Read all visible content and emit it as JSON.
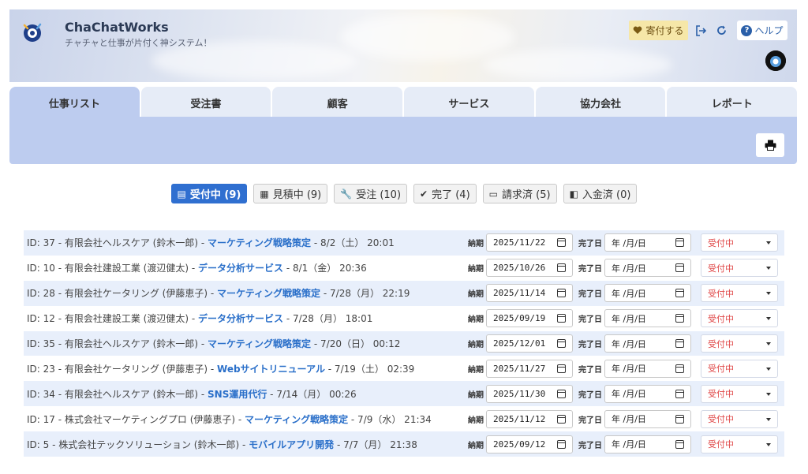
{
  "header": {
    "title": "ChaChatWorks",
    "subtitle": "チャチャと仕事が片付く神システム！",
    "donate_label": "寄付する",
    "help_label": "ヘルプ"
  },
  "tabs": [
    {
      "label": "仕事リスト",
      "active": true
    },
    {
      "label": "受注書"
    },
    {
      "label": "顧客"
    },
    {
      "label": "サービス"
    },
    {
      "label": "協力会社"
    },
    {
      "label": "レポート"
    }
  ],
  "filters": [
    {
      "icon": "list-icon",
      "glyph": "▤",
      "label": "受付中 (9)",
      "active": true
    },
    {
      "icon": "calculator-icon",
      "glyph": "▦",
      "label": "見積中 (9)"
    },
    {
      "icon": "wrench-icon",
      "glyph": "🔧",
      "label": "受注 (10)"
    },
    {
      "icon": "check-circle-icon",
      "glyph": "✔",
      "label": "完了 (4)"
    },
    {
      "icon": "credit-card-icon",
      "glyph": "▭",
      "label": "請求済 (5)"
    },
    {
      "icon": "wallet-icon",
      "glyph": "◧",
      "label": "入金済 (0)"
    }
  ],
  "labels": {
    "due": "納期",
    "done": "完了日",
    "date_placeholder": "年 /月/日"
  },
  "jobs": [
    {
      "prefix": "ID: 37 - 有限会社ヘルスケア (鈴木一郎) - ",
      "service": "マーケティング戦略策定",
      "suffix": " - 8/2（土） 20:01",
      "due": "2025/11/22",
      "status": "受付中"
    },
    {
      "prefix": "ID: 10 - 有限会社建設工業 (渡辺健太) - ",
      "service": "データ分析サービス",
      "suffix": " - 8/1（金） 20:36",
      "due": "2025/10/26",
      "status": "受付中"
    },
    {
      "prefix": "ID: 28 - 有限会社ケータリング (伊藤恵子) - ",
      "service": "マーケティング戦略策定",
      "suffix": " - 7/28（月） 22:19",
      "due": "2025/11/14",
      "status": "受付中"
    },
    {
      "prefix": "ID: 12 - 有限会社建設工業 (渡辺健太) - ",
      "service": "データ分析サービス",
      "suffix": " - 7/28（月） 18:01",
      "due": "2025/09/19",
      "status": "受付中"
    },
    {
      "prefix": "ID: 35 - 有限会社ヘルスケア (鈴木一郎) - ",
      "service": "マーケティング戦略策定",
      "suffix": " - 7/20（日） 00:12",
      "due": "2025/12/01",
      "status": "受付中"
    },
    {
      "prefix": "ID: 23 - 有限会社ケータリング (伊藤恵子) - ",
      "service": "Webサイトリニューアル",
      "suffix": " - 7/19（土） 02:39",
      "due": "2025/11/27",
      "status": "受付中"
    },
    {
      "prefix": "ID: 34 - 有限会社ヘルスケア (鈴木一郎) - ",
      "service": "SNS運用代行",
      "suffix": " - 7/14（月） 00:26",
      "due": "2025/11/30",
      "status": "受付中"
    },
    {
      "prefix": "ID: 17 - 株式会社マーケティングプロ (伊藤恵子) - ",
      "service": "マーケティング戦略策定",
      "suffix": " - 7/9（水） 21:34",
      "due": "2025/11/12",
      "status": "受付中"
    },
    {
      "prefix": "ID: 5 - 株式会社テックソリューション (鈴木一郎) - ",
      "service": "モバイルアプリ開発",
      "suffix": " - 7/7（月） 21:38",
      "due": "2025/09/12",
      "status": "受付中"
    }
  ]
}
